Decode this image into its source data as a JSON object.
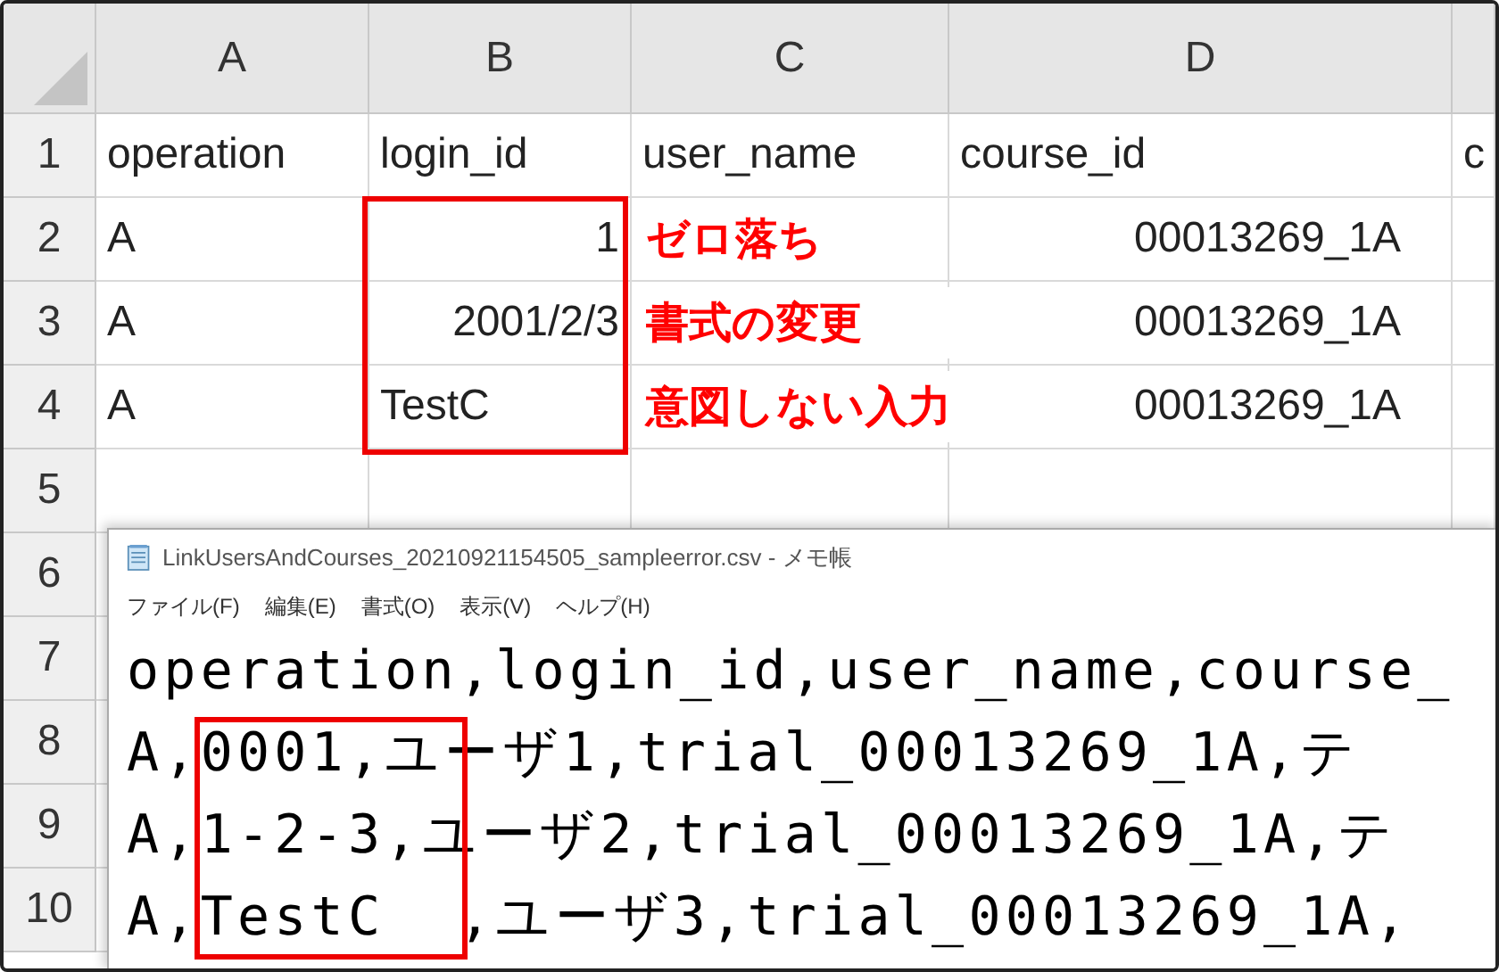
{
  "spreadsheet": {
    "columns": [
      "A",
      "B",
      "C",
      "D"
    ],
    "rows": [
      {
        "number": "1",
        "cells": [
          {
            "text": "operation"
          },
          {
            "text": "login_id"
          },
          {
            "text": "user_name"
          },
          {
            "text": "course_id"
          },
          {
            "text": "c"
          }
        ]
      },
      {
        "number": "2",
        "callout": "ゼロ落ち",
        "cells": [
          {
            "text": "A"
          },
          {
            "text": "1",
            "kind": "number",
            "highlighted": true
          },
          null,
          {
            "text": "00013269_1A",
            "kind": "covered"
          }
        ]
      },
      {
        "number": "3",
        "callout": "書式の変更",
        "cells": [
          {
            "text": "A"
          },
          {
            "text": "2001/2/3",
            "kind": "number",
            "highlighted": true
          },
          null,
          {
            "text": "00013269_1A",
            "kind": "covered"
          }
        ]
      },
      {
        "number": "4",
        "callout": "意図しない入力",
        "cells": [
          {
            "text": "A"
          },
          {
            "text": "TestC",
            "kind": "text",
            "highlighted": true
          },
          null,
          {
            "text": "00013269_1A",
            "kind": "covered"
          }
        ]
      },
      {
        "number": "5"
      },
      {
        "number": "6"
      },
      {
        "number": "7"
      },
      {
        "number": "8"
      },
      {
        "number": "9"
      },
      {
        "number": "10"
      }
    ]
  },
  "notepad": {
    "title": "LinkUsersAndCourses_20210921154505_sampleerror.csv - メモ帳",
    "menu": [
      "ファイル(F)",
      "編集(E)",
      "書式(O)",
      "表示(V)",
      "ヘルプ(H)"
    ],
    "lines": [
      {
        "text": "operation,login_id,user_name,course_"
      },
      {
        "before": "A,",
        "marked": "0001",
        "after": ",ユーザ1,trial_00013269_1A,テ"
      },
      {
        "before": "A,",
        "marked": "1-2-3",
        "after": ",ユーザ2,trial_00013269_1A,テ"
      },
      {
        "before": "A,",
        "marked": "TestC  ",
        "after": ",ユーザ3,trial_00013269_1A,"
      }
    ]
  }
}
